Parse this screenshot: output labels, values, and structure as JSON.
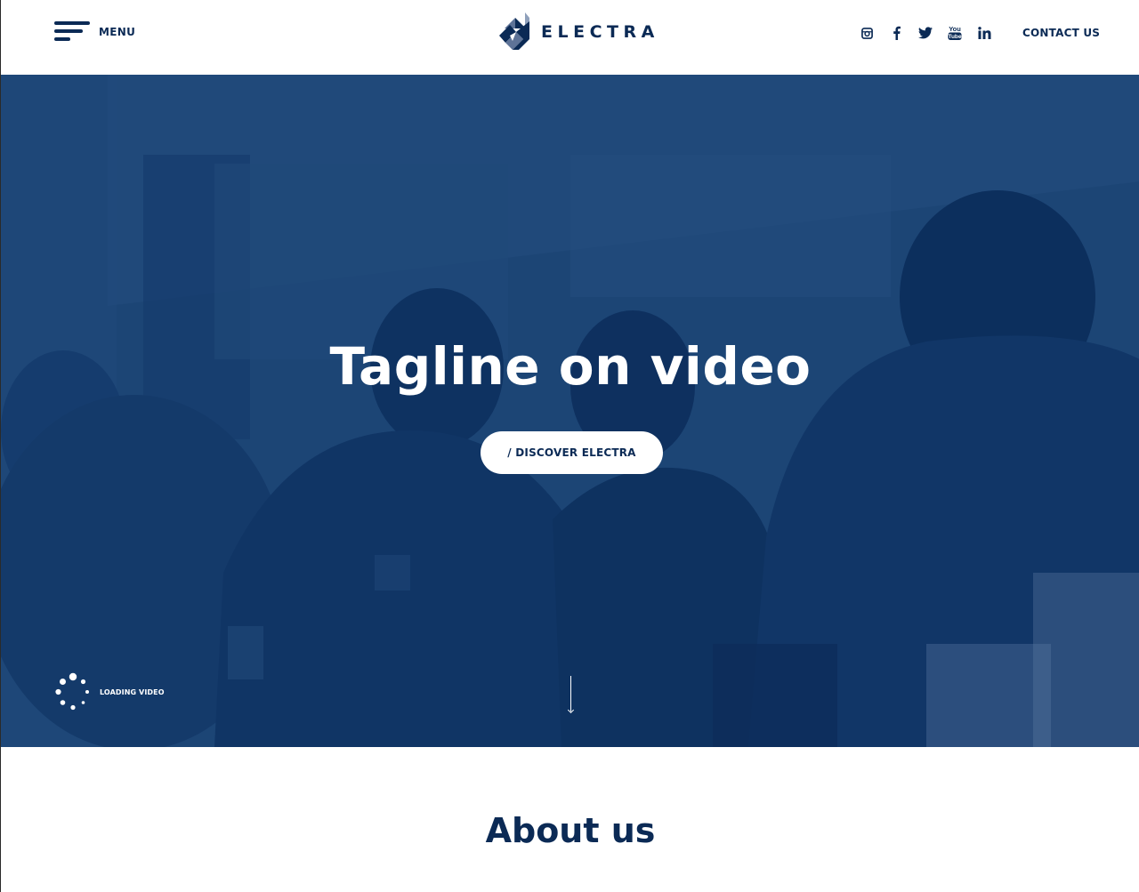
{
  "header": {
    "menu_label": "MENU",
    "logo_text": "ELECTRA",
    "socials": [
      {
        "name": "instagram"
      },
      {
        "name": "facebook"
      },
      {
        "name": "twitter"
      },
      {
        "name": "youtube",
        "text": "You Tube"
      },
      {
        "name": "linkedin"
      }
    ],
    "contact_label": "CONTACT US"
  },
  "hero": {
    "tagline": "Tagline on video",
    "cta_label": "/ DISCOVER ELECTRA",
    "loading_label": "LOADING VIDEO"
  },
  "about": {
    "title": "About us"
  },
  "colors": {
    "brand_navy": "#0b2a55",
    "hero_blue": "#1f4878",
    "white": "#ffffff"
  }
}
